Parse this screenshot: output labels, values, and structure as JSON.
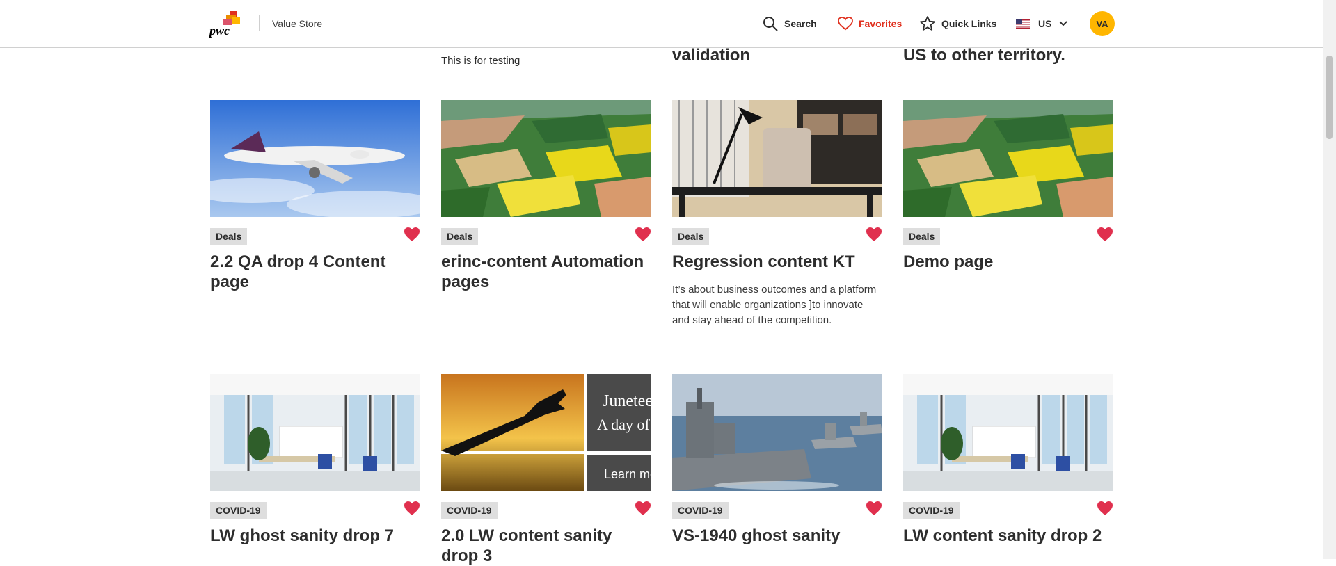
{
  "header": {
    "app_title": "Value Store",
    "search_label": "Search",
    "favorites_label": "Favorites",
    "quick_links_label": "Quick Links",
    "region_label": "US",
    "avatar_initials": "VA",
    "icons": [
      "pwc-logo",
      "search-icon",
      "heart-outline-icon",
      "star-outline-icon",
      "us-flag-icon",
      "chevron-down-icon"
    ]
  },
  "carry_over": {
    "col2_text": "This is for testing",
    "col3_text": "validation",
    "col4_text": "US to other territory."
  },
  "cards": [
    {
      "tag": "Deals",
      "title": "2.2 QA drop 4 Content page",
      "description": "",
      "image": "airplane",
      "favorited": true
    },
    {
      "tag": "Deals",
      "title": "erinc-content Automation pages",
      "description": "",
      "image": "fields",
      "favorited": true
    },
    {
      "tag": "Deals",
      "title": "Regression content KT",
      "description": "It’s about business outcomes and a platform that will enable organizations ]to innovate and stay ahead of the competition.",
      "image": "office-desk",
      "favorited": true
    },
    {
      "tag": "Deals",
      "title": "Demo page",
      "description": "",
      "image": "fields",
      "favorited": true
    },
    {
      "tag": "COVID-19",
      "title": "LW ghost sanity drop 7",
      "description": "",
      "image": "office-glass",
      "favorited": true
    },
    {
      "tag": "COVID-19",
      "title": "2.0 LW content sanity drop 3",
      "description": "",
      "image": "juneteenth-banner",
      "banner_line1": "Juneteenth",
      "banner_line2": "A day of",
      "banner_button": "Learn more",
      "favorited": true
    },
    {
      "tag": "COVID-19",
      "title": "VS-1940 ghost sanity",
      "description": "",
      "image": "warships",
      "favorited": true
    },
    {
      "tag": "COVID-19",
      "title": "LW content sanity drop 2",
      "description": "",
      "image": "office-glass",
      "favorited": true
    }
  ],
  "colors": {
    "accent_red": "#e0301e",
    "heart_red": "#e0304e",
    "avatar_bg": "#ffb600",
    "tag_bg": "#dedede"
  }
}
